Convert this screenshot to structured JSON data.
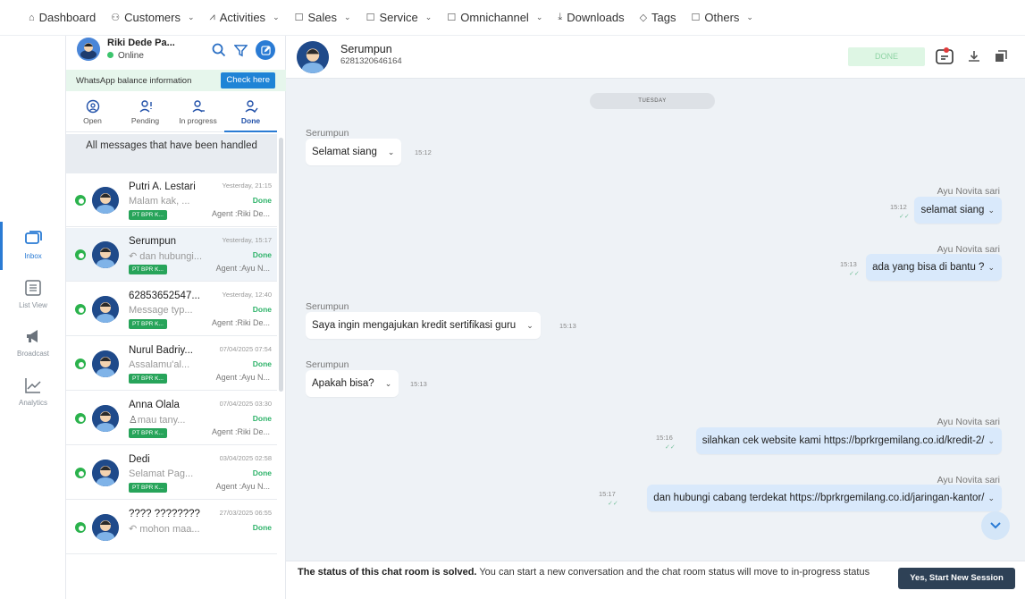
{
  "nav": [
    {
      "label": "Dashboard",
      "icon": "home-icon",
      "dropdown": false
    },
    {
      "label": "Customers",
      "icon": "users-icon",
      "dropdown": true
    },
    {
      "label": "Activities",
      "icon": "activity-icon",
      "dropdown": true
    },
    {
      "label": "Sales",
      "icon": "folder-icon",
      "dropdown": true
    },
    {
      "label": "Service",
      "icon": "folder-icon",
      "dropdown": true
    },
    {
      "label": "Omnichannel",
      "icon": "folder-icon",
      "dropdown": true
    },
    {
      "label": "Downloads",
      "icon": "download-icon",
      "dropdown": false
    },
    {
      "label": "Tags",
      "icon": "tag-icon",
      "dropdown": false
    },
    {
      "label": "Others",
      "icon": "folder-icon",
      "dropdown": true
    }
  ],
  "sidebar": {
    "items": [
      {
        "label": "Inbox",
        "icon": "inbox-icon",
        "active": true
      },
      {
        "label": "List View",
        "icon": "list-view-icon",
        "active": false
      },
      {
        "label": "Broadcast",
        "icon": "megaphone-icon",
        "active": false
      },
      {
        "label": "Analytics",
        "icon": "analytics-icon",
        "active": false
      }
    ]
  },
  "agent": {
    "name": "Riki Dede Pa...",
    "status": "Online"
  },
  "wa_balance": {
    "text": "WhatsApp balance information",
    "button": "Check here"
  },
  "tabs": [
    {
      "label": "Open",
      "icon": "open-icon"
    },
    {
      "label": "Pending",
      "icon": "pending-icon"
    },
    {
      "label": "In progress",
      "icon": "in-progress-icon"
    },
    {
      "label": "Done",
      "icon": "done-icon",
      "active": true
    }
  ],
  "handled_text": "All messages that have been handled",
  "conversations": [
    {
      "name": "Putri A. Lestari",
      "message": "Malam kak, ...",
      "company": "PT BPR K...",
      "time": "Yesterday, 21:15",
      "status": "Done",
      "agent": "Agent :Riki De..."
    },
    {
      "name": "Serumpun",
      "message": "dan hubungi...",
      "company": "PT BPR K...",
      "time": "Yesterday, 15:17",
      "status": "Done",
      "agent": "Agent :Ayu N..."
    },
    {
      "name": "62853652547...",
      "message": "Message typ...",
      "company": "PT BPR K...",
      "time": "Yesterday, 12:40",
      "status": "Done",
      "agent": "Agent :Riki De..."
    },
    {
      "name": "Nurul Badriy...",
      "message": "Assalamu'al...",
      "company": "PT BPR K...",
      "time": "07/04/2025 07:54",
      "status": "Done",
      "agent": "Agent :Ayu N..."
    },
    {
      "name": "Anna Olala",
      "message": "mau tany...",
      "company": "PT BPR K...",
      "time": "07/04/2025 03:30",
      "status": "Done",
      "agent": "Agent :Riki De..."
    },
    {
      "name": "Dedi",
      "message": "Selamat Pag...",
      "company": "PT BPR K...",
      "time": "03/04/2025 02:58",
      "status": "Done",
      "agent": "Agent :Ayu N..."
    },
    {
      "name": "???? ????????",
      "message": "mohon maa...",
      "company": "",
      "time": "27/03/2025 06:55",
      "status": "Done",
      "agent": ""
    }
  ],
  "chat": {
    "name": "Serumpun",
    "phone": "6281320646164",
    "done_label": "DONE",
    "day": "TUESDAY",
    "messages": [
      {
        "sender": "Serumpun",
        "text": "Selamat siang",
        "time": "15:12",
        "out": false
      },
      {
        "sender": "Ayu Novita sari",
        "text": "selamat siang",
        "time": "15:12",
        "out": true
      },
      {
        "sender": "Ayu Novita sari",
        "text": "ada yang bisa di bantu ?",
        "time": "15:13",
        "out": true
      },
      {
        "sender": "Serumpun",
        "text": "Saya ingin mengajukan kredit sertifikasi guru",
        "time": "15:13",
        "out": false
      },
      {
        "sender": "Serumpun",
        "text": "Apakah bisa?",
        "time": "15:13",
        "out": false
      },
      {
        "sender": "Ayu Novita sari",
        "text": "silahkan cek website kami https://bprkrgemilang.co.id/kredit-2/",
        "time": "15:16",
        "out": true
      },
      {
        "sender": "Ayu Novita sari",
        "text": "dan hubungi cabang terdekat https://bprkrgemilang.co.id/jaringan-kantor/",
        "time": "15:17",
        "out": true
      }
    ]
  },
  "status_bar": {
    "bold": "The status of this chat room is solved.",
    "text": " You can start a new conversation and the chat room status will move to in-progress status",
    "button": "Yes, Start New Session"
  },
  "colors": {
    "accent": "#2a7bd4",
    "whatsapp": "#2bb24c",
    "done_green": "#2fb36a",
    "button_dark": "#2e4156",
    "outgoing_bubble": "#d9e9fb"
  }
}
